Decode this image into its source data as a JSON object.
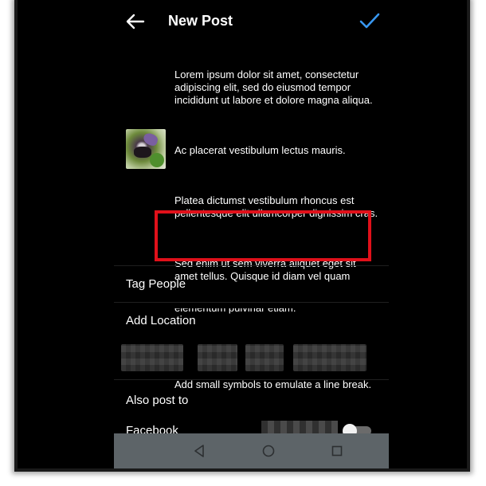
{
  "header": {
    "title": "New Post",
    "back_icon": "arrow-left-icon",
    "confirm_icon": "checkmark-icon",
    "accent_color": "#3897f0"
  },
  "caption": {
    "paragraph_1": "Lorem ipsum dolor sit amet, consectetur adipiscing elit, sed do eiusmod tempor incididunt ut labore et dolore magna aliqua.",
    "paragraph_2": "Ac placerat vestibulum lectus mauris.",
    "paragraph_3": "Platea dictumst vestibulum rhoncus est pellentesque elit ullamcorper dignissim cras.",
    "paragraph_4a": "Sed enim ut sem viverra aliquet eget sit amet tellus. Quisque id diam vel quam",
    "paragraph_4b": "elementum pulvinar etiam.",
    "dot": ".",
    "paragraph_5": "Add small symbols to emulate a line break."
  },
  "annotation": {
    "highlight_color": "#e0101a"
  },
  "options": {
    "tag_people": "Tag People",
    "add_location": "Add Location",
    "also_post_to": "Also post to",
    "facebook": "Facebook"
  },
  "navbar": {
    "back_icon": "triangle-back-icon",
    "home_icon": "circle-home-icon",
    "recents_icon": "square-recents-icon"
  }
}
